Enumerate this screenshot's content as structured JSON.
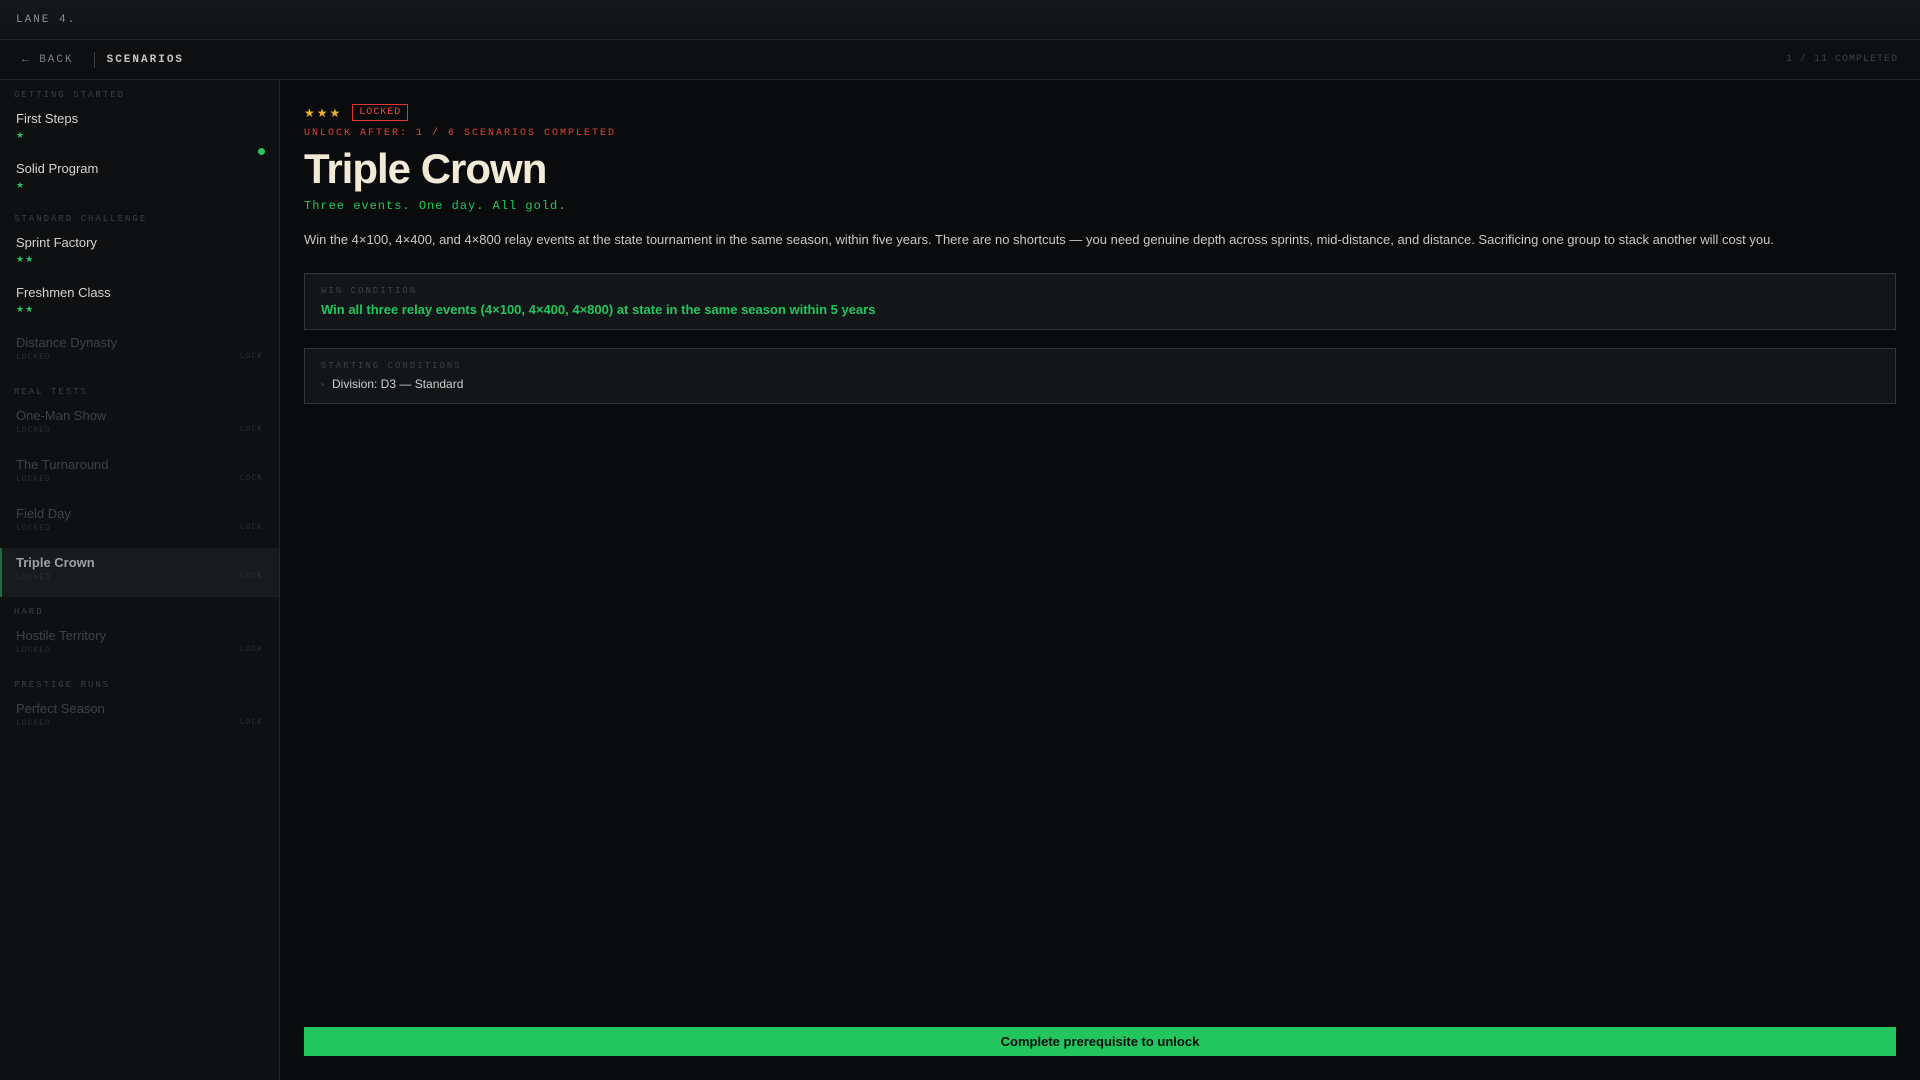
{
  "app": {
    "brand": "LANE 4."
  },
  "nav": {
    "back_label": "← BACK",
    "title": "SCENARIOS",
    "progress": "1 / 11 COMPLETED"
  },
  "sidebar": {
    "groups": [
      {
        "label": "GETTING STARTED",
        "items": [
          {
            "name": "First Steps",
            "stars": "★",
            "completed": true
          },
          {
            "name": "Solid Program",
            "stars": "★"
          }
        ]
      },
      {
        "label": "STANDARD CHALLENGE",
        "items": [
          {
            "name": "Sprint Factory",
            "stars": "★★"
          },
          {
            "name": "Freshmen Class",
            "stars": "★★"
          },
          {
            "name": "Distance Dynasty",
            "sub": "LOCKED",
            "lock": "LOCK"
          }
        ]
      },
      {
        "label": "REAL TESTS",
        "items": [
          {
            "name": "One-Man Show",
            "sub": "LOCKED",
            "lock": "LOCK"
          },
          {
            "name": "The Turnaround",
            "sub": "LOCKED",
            "lock": "LOCK"
          },
          {
            "name": "Field Day",
            "sub": "LOCKED",
            "lock": "LOCK"
          },
          {
            "name": "Triple Crown",
            "sub": "LOCKED",
            "lock": "LOCK",
            "active": true
          }
        ]
      },
      {
        "label": "HARD",
        "items": [
          {
            "name": "Hostile Territory",
            "sub": "LOCKED",
            "lock": "LOCK"
          }
        ]
      },
      {
        "label": "PRESTIGE RUNS",
        "items": [
          {
            "name": "Perfect Season",
            "sub": "LOCKED",
            "lock": "LOCK"
          }
        ]
      }
    ]
  },
  "scenario": {
    "difficulty_stars": "★★★",
    "status_badge": "LOCKED",
    "unlock_requirement": "UNLOCK AFTER: 1 / 6 SCENARIOS COMPLETED",
    "title": "Triple Crown",
    "tagline": "Three events. One day. All gold.",
    "description": "Win the 4×100, 4×400, and 4×800 relay events at the state tournament in the same season, within five years. There are no shortcuts — you need genuine depth across sprints, mid-distance, and distance. Sacrificing one group to stack another will cost you.",
    "win_condition": {
      "label": "WIN CONDITION",
      "text": "Win all three relay events (4×100, 4×400, 4×800) at state in the same season within 5 years"
    },
    "starting_conditions": {
      "label": "STARTING CONDITIONS",
      "items": [
        "Division: D3 — Standard"
      ]
    },
    "action_label": "Complete prerequisite to unlock"
  },
  "colors": {
    "accent": "#22c55e",
    "danger": "#ef4a3f",
    "star": "#f0b429",
    "title": "#f1ead7"
  }
}
